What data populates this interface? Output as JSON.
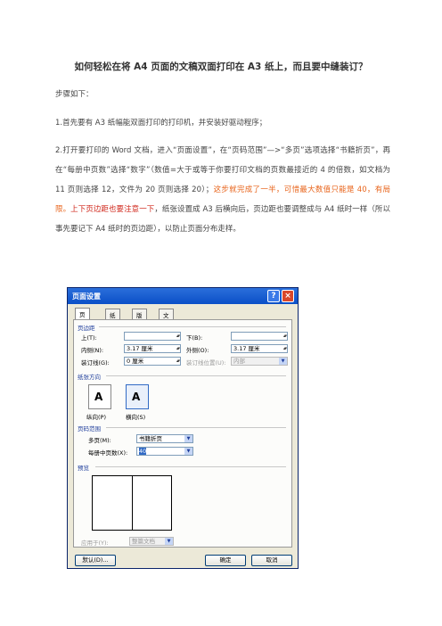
{
  "article": {
    "title": "如何轻松在将 A4 页面的文稿双面打印在 A3 纸上，而且要中缝装订？",
    "steps_label": "步骤如下：",
    "step1": "1.首先要有 A3 纸幅能双面打印的打印机，并安装好驱动程序；",
    "step2_plain": "2.打开要打印的 Word 文档，进入“页面设置”，在“页码范围”—>“多页”选项选择“书籍折页”，再在“每册中页数”选择“数字”（数值=大于或等于你要打印文档的页数最接近的 4 的倍数，如文档为 11 页则选择 12，文件为 20 页则选择 20）；",
    "step2_orange": "这步就完成了一半，可惜最大数值只能是 40，有局限。",
    "step2_red": "上下页边距也要注意一下",
    "step2_tail": "，纸张设置成 A3 后横向后，页边距也要调整成与 A4 纸时一样（所以事先要记下 A4 纸时的页边距），以防止页面分布走样。"
  },
  "dialog": {
    "title": "页面设置",
    "help_glyph": "?",
    "close_glyph": "×",
    "tabs": [
      "页边距",
      "纸张",
      "版式",
      "文档网格"
    ],
    "margins_group": "页边距",
    "top_label": "上(T):",
    "bottom_label": "下(B):",
    "inside_label": "内侧(N):",
    "inside_value": "3.17 厘米",
    "outside_label": "外侧(O):",
    "outside_value": "3.17 厘米",
    "gutter_label": "装订线(G):",
    "gutter_value": "0 厘米",
    "gutter_pos_label": "装订线位置(U):",
    "gutter_pos_value": "内部",
    "orientation_group": "纸张方向",
    "portrait_label": "纵向(P)",
    "landscape_label": "横向(S)",
    "orient_glyph": "A",
    "pages_group": "页码范围",
    "multipage_label": "多页(M):",
    "multipage_value": "书籍折页",
    "sheets_label": "每册中页数(X):",
    "sheets_value": "40",
    "preview_group": "预览",
    "apply_label": "应用于(Y):",
    "apply_value": "整篇文档",
    "default_button": "默认(D)...",
    "ok_button": "确定",
    "cancel_button": "取消"
  },
  "colors": {
    "orange": "#e8641b",
    "red": "#d0281c",
    "titlebar": "#0a4fc7"
  }
}
